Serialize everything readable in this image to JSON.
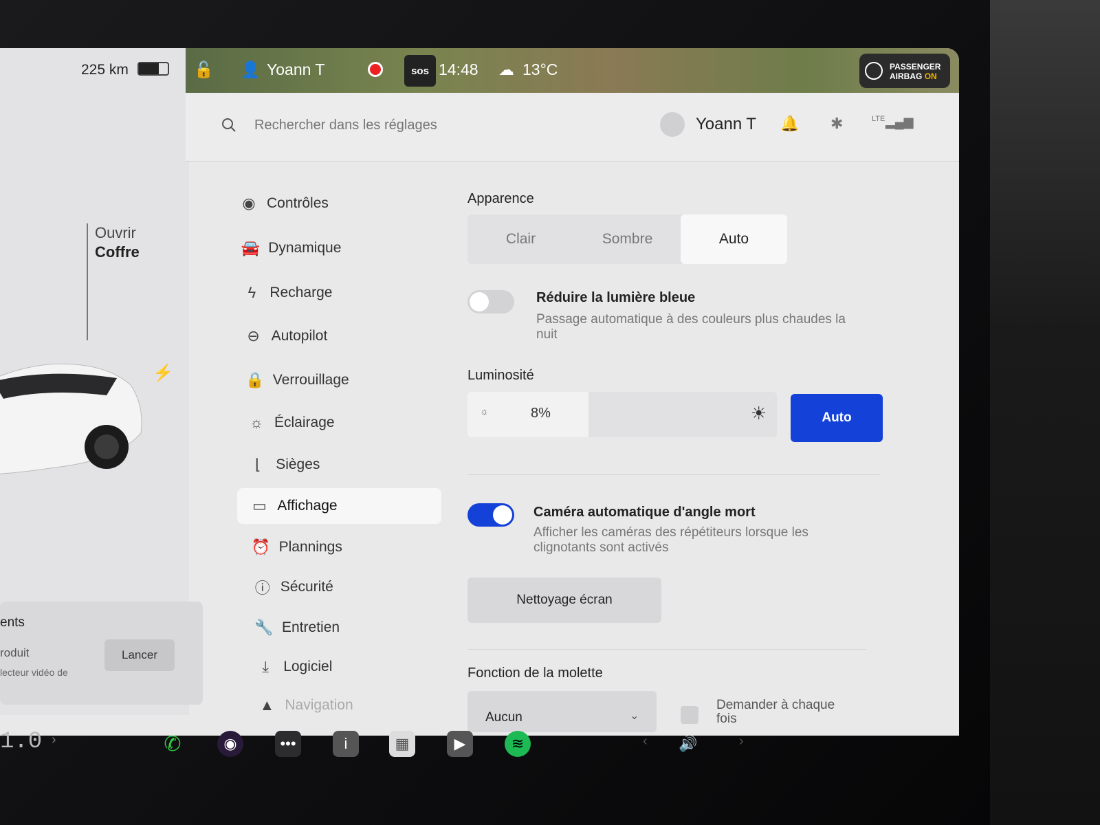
{
  "car_panel": {
    "range": "225 km",
    "trunk_line1": "Ouvrir",
    "trunk_line2": "Coffre",
    "media_title": "ents",
    "media_sub": "roduit",
    "media_sub2": "lecteur vidéo de",
    "launch_label": "Lancer"
  },
  "status_bar": {
    "user": "Yoann T",
    "sos": "sos",
    "time": "14:48",
    "temperature": "13°C",
    "airbag_line1": "PASSENGER",
    "airbag_line2_prefix": "AIRBAG",
    "airbag_line2_status": "ON"
  },
  "header": {
    "search_placeholder": "Rechercher dans les réglages",
    "user": "Yoann T",
    "network": "LTE"
  },
  "nav": {
    "items": [
      {
        "label": "Contrôles",
        "icon": "toggle-icon"
      },
      {
        "label": "Dynamique",
        "icon": "car-icon"
      },
      {
        "label": "Recharge",
        "icon": "bolt-icon"
      },
      {
        "label": "Autopilot",
        "icon": "steering-wheel-icon"
      },
      {
        "label": "Verrouillage",
        "icon": "lock-icon"
      },
      {
        "label": "Éclairage",
        "icon": "light-icon"
      },
      {
        "label": "Sièges",
        "icon": "seat-icon"
      },
      {
        "label": "Affichage",
        "icon": "display-icon"
      },
      {
        "label": "Plannings",
        "icon": "alarm-clock-icon"
      },
      {
        "label": "Sécurité",
        "icon": "alert-icon"
      },
      {
        "label": "Entretien",
        "icon": "wrench-icon"
      },
      {
        "label": "Logiciel",
        "icon": "download-icon"
      },
      {
        "label": "Navigation",
        "icon": "navigation-icon"
      }
    ],
    "active": "Affichage"
  },
  "display": {
    "appearance_title": "Apparence",
    "appearance_options": [
      "Clair",
      "Sombre",
      "Auto"
    ],
    "appearance_selected": "Auto",
    "blue_light_title": "Réduire la lumière bleue",
    "blue_light_desc_1": "Passage automatique à des couleurs plus chaudes la",
    "blue_light_desc_2": "nuit",
    "blue_light_enabled": false,
    "brightness_title": "Luminosité",
    "brightness_value": "8%",
    "brightness_fraction": 0.08,
    "brightness_auto_label": "Auto",
    "blind_spot_title": "Caméra automatique d'angle mort",
    "blind_spot_desc_1": "Afficher les caméras des répétiteurs lorsque les",
    "blind_spot_desc_2": "clignotants sont activés",
    "blind_spot_enabled": true,
    "clean_screen_label": "Nettoyage écran",
    "scroll_wheel_title": "Fonction de la molette",
    "scroll_wheel_value": "Aucun",
    "ask_each_time_label": "Demander à chaque fois"
  },
  "dock": {
    "speed": "1.0",
    "colors": {
      "phone": "#2ecc40",
      "spotify": "#1db954",
      "accent": "#1441d8"
    }
  }
}
